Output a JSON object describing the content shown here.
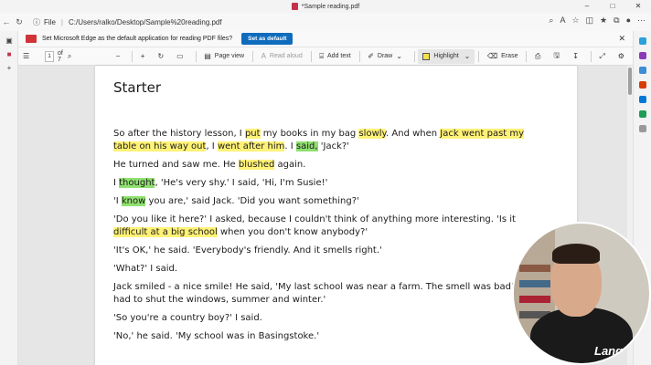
{
  "window": {
    "title": "*Sample reading.pdf"
  },
  "address": {
    "file_label": "File",
    "url": "C:/Users/ralko/Desktop/Sample%20reading.pdf"
  },
  "infobar": {
    "message": "Set Microsoft Edge as the default application for reading PDF files?",
    "button": "Set as default"
  },
  "toolbar": {
    "page_current": "1",
    "page_total": "of 7",
    "page_view": "Page view",
    "read_aloud": "Read aloud",
    "add_text": "Add text",
    "draw": "Draw",
    "highlight": "Highlight",
    "erase": "Erase"
  },
  "document": {
    "title": "Starter",
    "paragraphs": [
      [
        {
          "t": "So after the history lesson, I "
        },
        {
          "t": "put",
          "hl": "y"
        },
        {
          "t": " my books in my bag "
        },
        {
          "t": "slowly",
          "hl": "y"
        },
        {
          "t": ". And when "
        },
        {
          "t": "Jack went past my table on his way out",
          "hl": "y"
        },
        {
          "t": ", I "
        },
        {
          "t": "went after him",
          "hl": "y"
        },
        {
          "t": ". I "
        },
        {
          "t": "said,",
          "hl": "g"
        },
        {
          "t": " 'Jack?'"
        }
      ],
      [
        {
          "t": "He turned and saw me. He "
        },
        {
          "t": "blushed",
          "hl": "y"
        },
        {
          "t": " again."
        }
      ],
      [
        {
          "t": "I "
        },
        {
          "t": "thought",
          "hl": "g"
        },
        {
          "t": ", 'He's very shy.' I said, 'Hi, I'm Susie!'"
        }
      ],
      [
        {
          "t": "'I "
        },
        {
          "t": "know",
          "hl": "g"
        },
        {
          "t": " you are,' said Jack. 'Did you want something?'"
        }
      ],
      [
        {
          "t": "'Do you like it here?' I asked, because I couldn't think of anything more interesting. 'Is it "
        },
        {
          "t": "difficult at a big school",
          "hl": "y"
        },
        {
          "t": " when you don't know anybody?'"
        }
      ],
      [
        {
          "t": "'It's OK,' he said. 'Everybody's friendly. And it smells right.'"
        }
      ],
      [
        {
          "t": "'What?' I said."
        }
      ],
      [
        {
          "t": "Jack smiled - a nice smile! He said, 'My last school was near a farm. The smell was bad! We had to shut the windows, summer and winter.'"
        }
      ],
      [
        {
          "t": "'So you're a country boy?' I said."
        }
      ],
      [
        {
          "t": "'No,' he said. 'My school was in Basingstoke.'"
        }
      ]
    ]
  },
  "webcam": {
    "logo": "Lang"
  },
  "colors": {
    "highlight_yellow": "#fff276",
    "highlight_green": "#8fe06f",
    "accent": "#0f6cbd"
  }
}
